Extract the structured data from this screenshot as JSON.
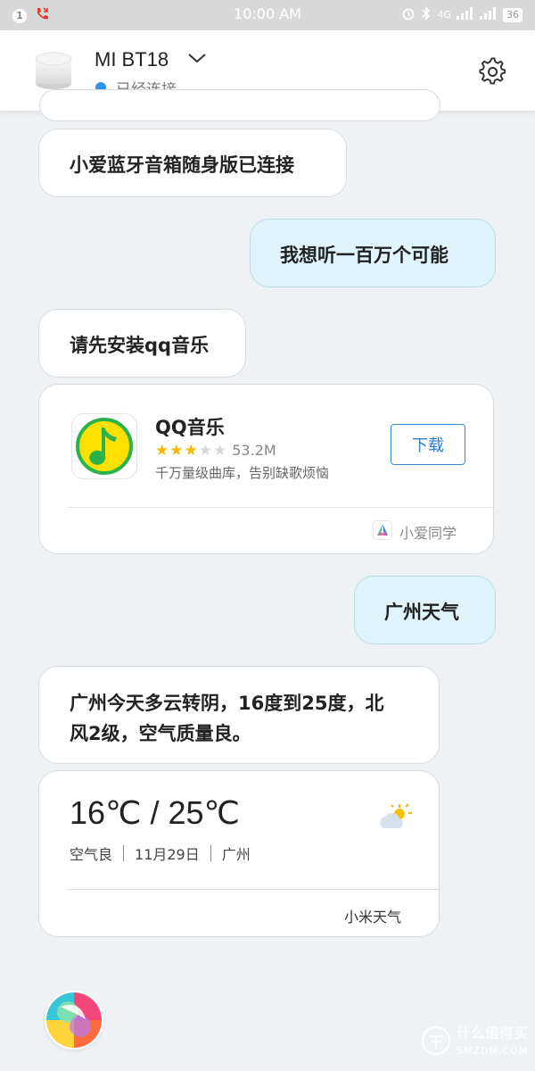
{
  "statusbar": {
    "notification_count": "1",
    "time": "10:00 AM",
    "network": "4G",
    "battery": "36"
  },
  "header": {
    "device_name": "MI BT18",
    "connection_status": "已经连接"
  },
  "messages": [
    {
      "role": "assistant",
      "text": "小爱蓝牙音箱随身版已连接"
    },
    {
      "role": "user",
      "text": "我想听一百万个可能"
    },
    {
      "role": "assistant",
      "text": "请先安装qq音乐"
    },
    {
      "role": "user",
      "text": "广州天气"
    },
    {
      "role": "assistant",
      "text_line1": "广州今天多云转阴，16度到25度，北",
      "text_line2": "风2级，空气质量良。"
    }
  ],
  "app_card": {
    "name": "QQ音乐",
    "rating": 3,
    "rating_max": 5,
    "size": "53.2M",
    "description": "千万量级曲库，告别缺歌烦恼",
    "download_label": "下载",
    "source": "小爱同学"
  },
  "weather_card": {
    "temperature": "16℃ / 25℃",
    "air": "空气良",
    "date": "11月29日",
    "city": "广州",
    "source": "小米天气"
  },
  "watermark": {
    "title": "什么值得买",
    "subtitle": "SMZDM.COM"
  },
  "colors": {
    "accent_blue": "#2f95f2",
    "user_bubble": "#dff4fb",
    "star": "#f7b800",
    "qq_green": "#2bb24c",
    "qq_yellow": "#ffe000"
  }
}
